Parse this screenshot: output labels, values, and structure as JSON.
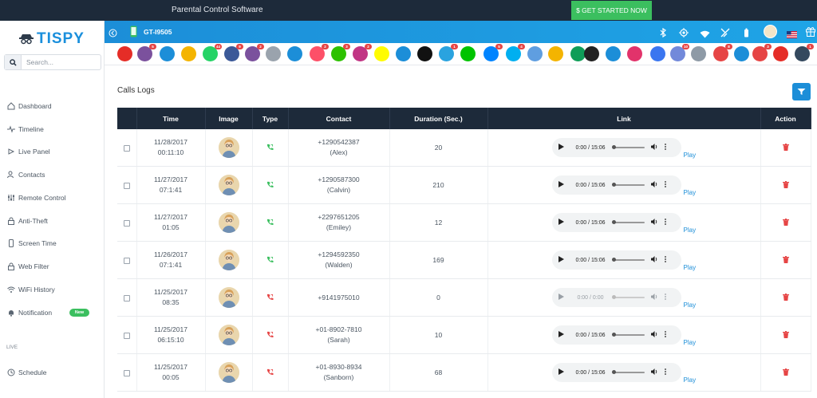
{
  "topbar": {
    "title": "Parental Control Software",
    "cta": "$ GET STARTED NOW"
  },
  "brand": {
    "logo_text": "TISPY",
    "accent": "#1a8fdc"
  },
  "search": {
    "placeholder": "Search..."
  },
  "sidebar": {
    "items": [
      {
        "label": "Dashboard",
        "icon": "home-icon"
      },
      {
        "label": "Timeline",
        "icon": "pulse-icon"
      },
      {
        "label": "Live Panel",
        "icon": "live-icon"
      },
      {
        "label": "Contacts",
        "icon": "contacts-icon"
      },
      {
        "label": "Remote Control",
        "icon": "sliders-icon"
      },
      {
        "label": "Anti-Theft",
        "icon": "lock-icon"
      },
      {
        "label": "Screen Time",
        "icon": "phone-icon"
      },
      {
        "label": "Web Filter",
        "icon": "lock-icon"
      },
      {
        "label": "WiFi History",
        "icon": "wifi-icon"
      },
      {
        "label": "Notification",
        "icon": "bell-icon"
      }
    ],
    "new_badge": "New",
    "section_live": "LIVE",
    "schedule": "Schedule"
  },
  "device": {
    "name": "GT-I9505"
  },
  "apps": [
    {
      "name": "youtube-icon",
      "color": "#e52d27"
    },
    {
      "name": "viber-icon",
      "color": "#7b519d",
      "badge": "5"
    },
    {
      "name": "mail-icon",
      "color": "#1c8ed8"
    },
    {
      "name": "notes-icon",
      "color": "#f4b400"
    },
    {
      "name": "whatsapp-icon",
      "color": "#25d366",
      "badge": "44"
    },
    {
      "name": "facebook-icon",
      "color": "#3b5998",
      "badge": "9"
    },
    {
      "name": "viber2-icon",
      "color": "#7b519d",
      "badge": "2"
    },
    {
      "name": "files-icon",
      "color": "#9aa3ad"
    },
    {
      "name": "screen-icon",
      "color": "#1c8ed8"
    },
    {
      "name": "tinder-icon",
      "color": "#fd5068",
      "badge": "2"
    },
    {
      "name": "wechat-icon",
      "color": "#2dc100",
      "badge": "3"
    },
    {
      "name": "instagram-icon",
      "color": "#c13584",
      "badge": "2"
    },
    {
      "name": "snapchat-icon",
      "color": "#fffc00"
    },
    {
      "name": "chat-icon",
      "color": "#1c8ed8"
    },
    {
      "name": "tiktok-icon",
      "color": "#111111"
    },
    {
      "name": "telegram-icon",
      "color": "#2aa3df",
      "badge": "1"
    },
    {
      "name": "line-icon",
      "color": "#00c300"
    },
    {
      "name": "messenger-icon",
      "color": "#0084ff",
      "badge": "5"
    },
    {
      "name": "skype-icon",
      "color": "#00aff0",
      "badge": "4"
    },
    {
      "name": "blip-icon",
      "color": "#5f9ee0"
    },
    {
      "name": "zalo-icon",
      "color": "#f4b400"
    },
    {
      "name": "hangouts-icon",
      "color": "#0f9d58"
    },
    {
      "name": "kik-icon",
      "color": "#222222"
    },
    {
      "name": "imo-icon",
      "color": "#1c8ed8"
    },
    {
      "name": "video-icon",
      "color": "#e2336b"
    },
    {
      "name": "signal-icon",
      "color": "#3a76f0"
    },
    {
      "name": "discord-icon",
      "color": "#7289da",
      "badge": "10"
    },
    {
      "name": "settings-app-icon",
      "color": "#8e9aa6"
    },
    {
      "name": "gallery-icon",
      "color": "#e64545",
      "badge": "8"
    },
    {
      "name": "phone-app-icon",
      "color": "#1c8ed8"
    },
    {
      "name": "browser-icon",
      "color": "#e64545",
      "badge": "3"
    },
    {
      "name": "youtube2-icon",
      "color": "#e52d27"
    },
    {
      "name": "keylog-icon",
      "color": "#34495e",
      "badge": "1"
    }
  ],
  "page": {
    "title": "Calls Logs"
  },
  "table": {
    "headers": [
      "",
      "Time",
      "Image",
      "Type",
      "Contact",
      "Duration (Sec.)",
      "Link",
      "Action"
    ],
    "play_label": "Play",
    "rows": [
      {
        "date": "11/28/2017",
        "time": "00:11:10",
        "type": "incoming",
        "number": "+1290542387",
        "name": "(Alex)",
        "duration": "20",
        "audio": "0:00 / 15:06",
        "enabled": true
      },
      {
        "date": "11/27/2017",
        "time": "07:1:41",
        "type": "incoming",
        "number": "+1290587300",
        "name": "(Calvin)",
        "duration": "210",
        "audio": "0:00 / 15:06",
        "enabled": true
      },
      {
        "date": "11/27/2017",
        "time": "01:05",
        "type": "incoming",
        "number": "+2297651205",
        "name": "(Emiley)",
        "duration": "12",
        "audio": "0:00 / 15:06",
        "enabled": true
      },
      {
        "date": "11/26/2017",
        "time": "07:1:41",
        "type": "incoming",
        "number": "+1294592350",
        "name": "(Walden)",
        "duration": "169",
        "audio": "0:00 / 15:06",
        "enabled": true
      },
      {
        "date": "11/25/2017",
        "time": "08:35",
        "type": "outgoing",
        "number": "+9141975010",
        "name": "",
        "duration": "0",
        "audio": "0:00 / 0:00",
        "enabled": false
      },
      {
        "date": "11/25/2017",
        "time": "06:15:10",
        "type": "outgoing",
        "number": "+01-8902-7810",
        "name": "(Sarah)",
        "duration": "10",
        "audio": "0:00 / 15:06",
        "enabled": true
      },
      {
        "date": "11/25/2017",
        "time": "00:05",
        "type": "outgoing",
        "number": "+01-8930-8934",
        "name": "(Sanborn)",
        "duration": "68",
        "audio": "0:00 / 15:06",
        "enabled": true
      }
    ]
  }
}
